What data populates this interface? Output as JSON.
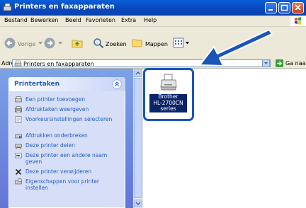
{
  "window": {
    "title": "Printers en faxapparaten"
  },
  "menu": [
    "Bestand",
    "Bewerken",
    "Beeld",
    "Favorieten",
    "Extra",
    "Help"
  ],
  "toolbar": {
    "back_label": "Vorige",
    "search_label": "Zoeken",
    "folders_label": "Mappen"
  },
  "address": {
    "label": "Adres",
    "value": "Printers en faxapparaten",
    "go_label": "Ga naar"
  },
  "sidebar": {
    "panel_title": "Printertaken",
    "tasks": [
      {
        "label": "Een printer toevoegen",
        "icon": "add-printer-icon"
      },
      {
        "label": "Afdruktaken weergeven",
        "icon": "print-jobs-icon"
      },
      {
        "label": "Voorkeursinstellingen selecteren",
        "icon": "preferences-icon"
      },
      {
        "label": "Afdrukken onderbreken",
        "icon": "pause-printing-icon"
      },
      {
        "label": "Deze printer delen",
        "icon": "share-printer-icon"
      },
      {
        "label": "Deze printer een andere naam geven",
        "icon": "rename-icon"
      },
      {
        "label": "Deze printer verwijderen",
        "icon": "delete-icon"
      },
      {
        "label": "Eigenschappen voor printer instellen",
        "icon": "properties-icon"
      }
    ]
  },
  "printer": {
    "line1": "Brother",
    "line2": "HL-2700CN",
    "line3": "series",
    "selection_color": "#1a55b8"
  },
  "annotation": {
    "arrow_color": "#1a55b8"
  }
}
